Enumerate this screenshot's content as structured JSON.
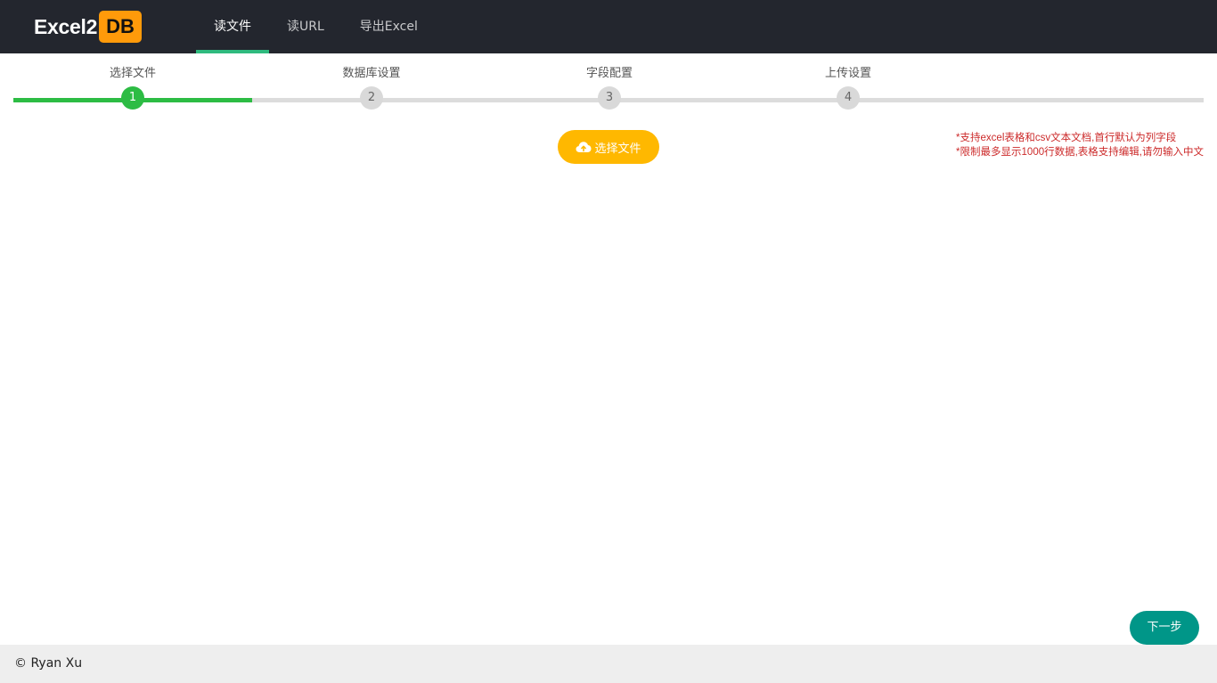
{
  "brand": {
    "text": "Excel2",
    "badge": "DB"
  },
  "nav": {
    "items": [
      {
        "label": "读文件",
        "active": true
      },
      {
        "label": "读URL",
        "active": false
      },
      {
        "label": "导出Excel",
        "active": false
      }
    ]
  },
  "steps": {
    "current": 1,
    "items": [
      {
        "label": "选择文件",
        "number": "1"
      },
      {
        "label": "数据库设置",
        "number": "2"
      },
      {
        "label": "字段配置",
        "number": "3"
      },
      {
        "label": "上传设置",
        "number": "4"
      }
    ]
  },
  "upload": {
    "label": "选择文件",
    "icon": "cloud-upload-icon"
  },
  "notes": [
    "*支持excel表格和csv文本文档,首行默认为列字段",
    "*限制最多显示1000行数据,表格支持编辑,请勿输入中文"
  ],
  "next": {
    "label": "下一步"
  },
  "footer": {
    "text": "© Ryan Xu"
  },
  "colors": {
    "navbar": "#23262e",
    "nav_active": "#2fba7e",
    "logo_badge": "#ff9a0a",
    "step_done": "#2dbc44",
    "step_pending": "#d9d9d9",
    "upload_button": "#ffb800",
    "next_button": "#009688",
    "notes": "#cc2a2a",
    "footer": "#eeeeee"
  }
}
